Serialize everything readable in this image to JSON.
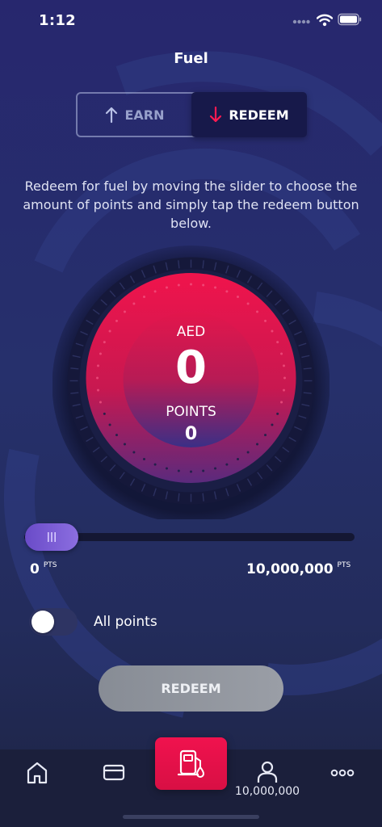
{
  "status_bar": {
    "time": "1:12"
  },
  "header": {
    "title": "Fuel"
  },
  "tabs": {
    "earn_label": "EARN",
    "redeem_label": "REDEEM",
    "active": "REDEEM"
  },
  "description": "Redeem for fuel by moving the slider to choose the amount of points and simply tap the redeem button below.",
  "dial": {
    "currency_label": "AED",
    "amount": "0",
    "points_label": "POINTS",
    "points_value": "0"
  },
  "slider": {
    "min_value": "0",
    "max_value": "10,000,000",
    "unit": "PTS",
    "current_fraction": 0
  },
  "toggle": {
    "label": "All points",
    "on": false
  },
  "redeem_button": {
    "label": "REDEEM"
  },
  "bottom_nav": {
    "items": [
      {
        "icon": "home-icon"
      },
      {
        "icon": "card-icon"
      },
      {
        "icon": "fuel-pump-icon",
        "active": true
      },
      {
        "icon": "user-icon",
        "label": "10,000,000"
      },
      {
        "icon": "more-icon"
      }
    ]
  },
  "colors": {
    "accent": "#e5134b",
    "background": "#27276e",
    "slider_thumb": "#7556d2"
  }
}
